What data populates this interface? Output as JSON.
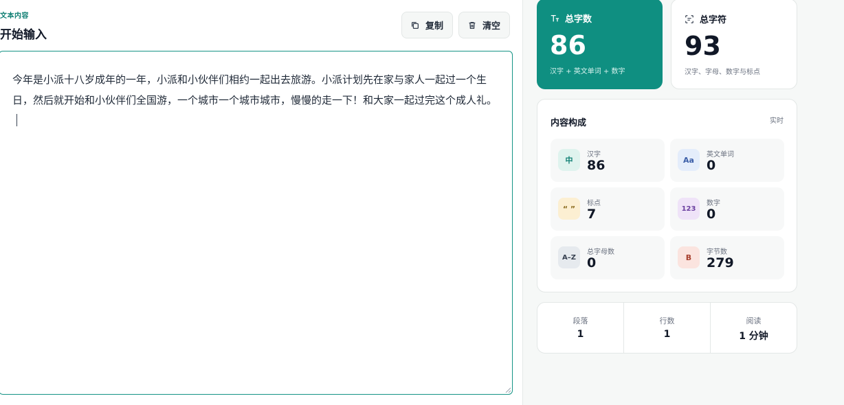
{
  "editor": {
    "eyebrow": "文本内容",
    "title": "开始输入",
    "copy_label": "复制",
    "clear_label": "清空",
    "text": "今年是小派十八岁成年的一年，小派和小伙伴们相约一起出去旅游。小派计划先在家与家人一起过一个生日，然后就开始和小伙伴们全国游，一个城市一个城市城市，慢慢的走一下！和大家一起过完这个成人礼。"
  },
  "stats": {
    "total_words": {
      "label": "总字数",
      "value": "86",
      "sub": "汉字 + 英文单词 + 数字"
    },
    "total_chars": {
      "label": "总字符",
      "value": "93",
      "sub": "汉字、字母、数字与标点"
    }
  },
  "composition": {
    "title": "内容构成",
    "tag": "实时",
    "items": [
      {
        "icon": "中",
        "label": "汉字",
        "value": "86"
      },
      {
        "icon": "Aa",
        "label": "英文单词",
        "value": "0"
      },
      {
        "icon": "“ ”",
        "label": "标点",
        "value": "7"
      },
      {
        "icon": "123",
        "label": "数字",
        "value": "0"
      },
      {
        "icon": "A–Z",
        "label": "总字母数",
        "value": "0"
      },
      {
        "icon": "B",
        "label": "字节数",
        "value": "279"
      }
    ]
  },
  "summary": [
    {
      "label": "段落",
      "value": "1"
    },
    {
      "label": "行数",
      "value": "1"
    },
    {
      "label": "阅读",
      "value": "1 分钟"
    }
  ],
  "colors": {
    "accent": "#0f8f81",
    "border": "#e3e7e6"
  }
}
